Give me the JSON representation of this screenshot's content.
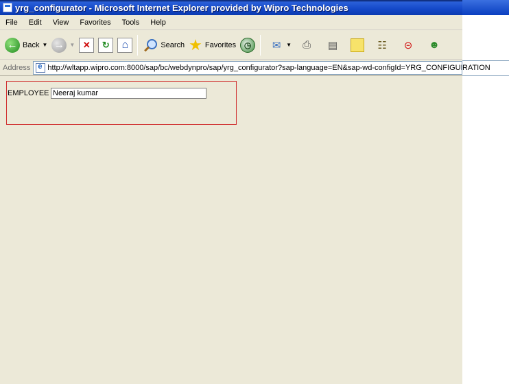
{
  "window": {
    "title": "yrg_configurator - Microsoft Internet Explorer provided by Wipro Technologies"
  },
  "menu": {
    "items": [
      "File",
      "Edit",
      "View",
      "Favorites",
      "Tools",
      "Help"
    ]
  },
  "toolbar": {
    "back_label": "Back",
    "search_label": "Search",
    "favorites_label": "Favorites"
  },
  "address": {
    "label": "Address",
    "url": "http://wltapp.wipro.com:8000/sap/bc/webdynpro/sap/yrg_configurator?sap-language=EN&sap-wd-configId=YRG_CONFIGURATION"
  },
  "overflow": {
    "url_tail": "RATION"
  },
  "form": {
    "employee_label": "EMPLOYEE",
    "employee_value": "Neeraj kumar"
  },
  "colors": {
    "titlebar": "#0a3ab0",
    "chrome": "#ece9d8",
    "group_border": "#d03030"
  }
}
